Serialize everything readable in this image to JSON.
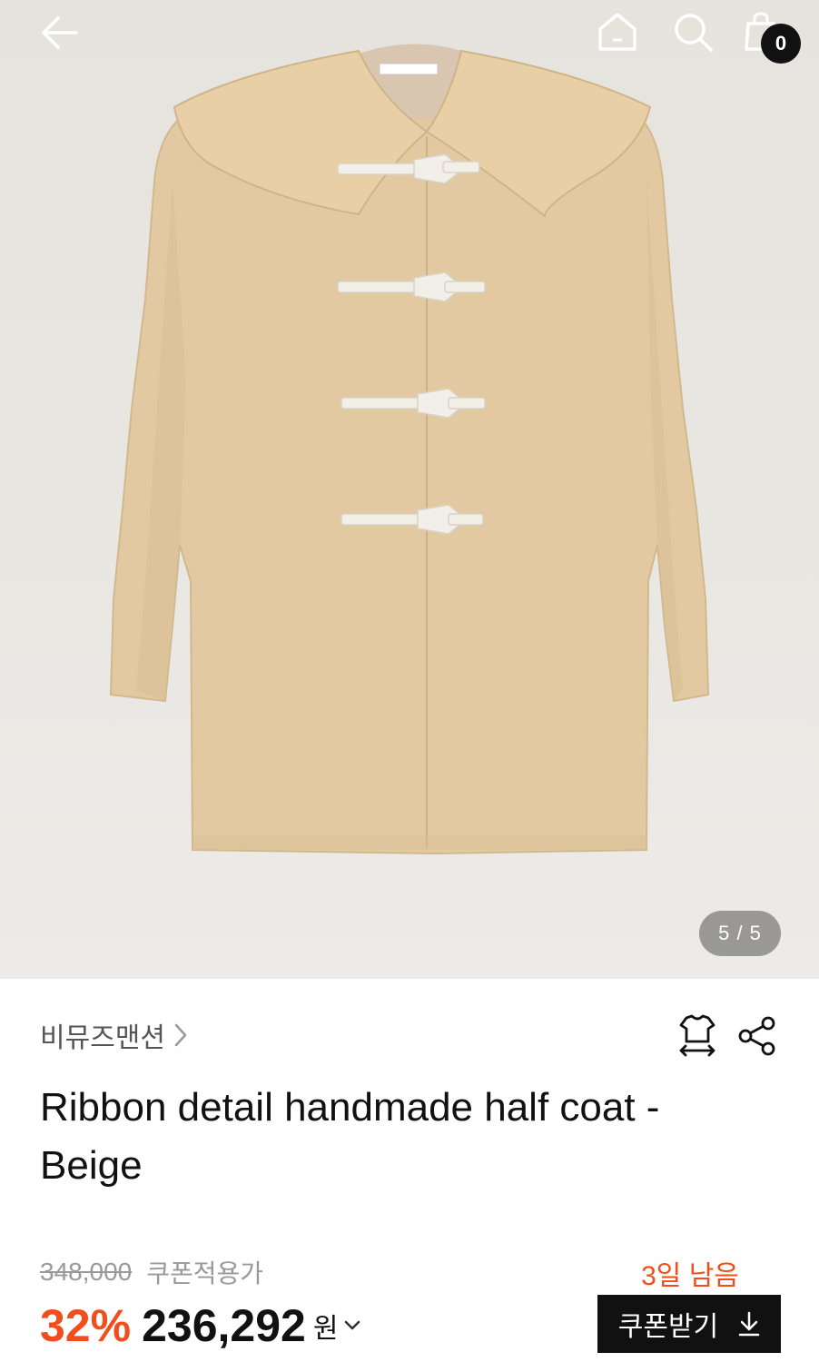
{
  "header": {
    "icons": [
      "back-arrow-icon",
      "home-icon",
      "search-icon",
      "shopping-bag-icon"
    ],
    "cart_count": "0"
  },
  "gallery": {
    "counter": "5 / 5"
  },
  "product": {
    "brand": "비뮤즈맨션",
    "title": "Ribbon detail handmade half coat - Beige",
    "actions": [
      "size-guide-icon",
      "share-icon"
    ]
  },
  "pricing": {
    "original_price": "348,000",
    "price_label": "쿠폰적용가",
    "discount": "32%",
    "final_price": "236,292",
    "currency": "원"
  },
  "coupon": {
    "days_left": "3일 남음",
    "button_label": "쿠폰받기"
  },
  "colors": {
    "accent": "#f04e1d",
    "coat": "#e3c9a1",
    "button": "#111111"
  }
}
